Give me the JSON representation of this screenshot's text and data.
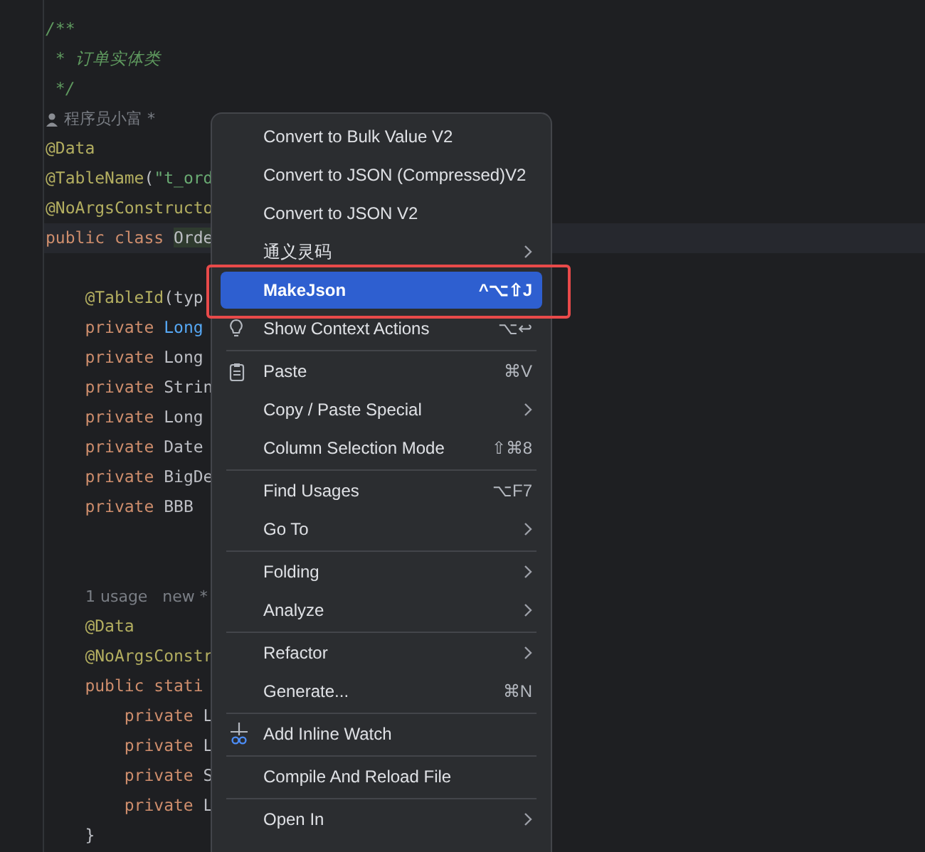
{
  "editor": {
    "lines": [
      {
        "kind": "code",
        "tokens": [
          {
            "kind": "comment",
            "text": "/**"
          }
        ]
      },
      {
        "kind": "code",
        "tokens": [
          {
            "kind": "comment",
            "text": " * 订单实体类"
          }
        ]
      },
      {
        "kind": "code",
        "tokens": [
          {
            "kind": "comment",
            "text": " */"
          }
        ]
      },
      {
        "kind": "author",
        "text": "程序员小富 *"
      },
      {
        "kind": "code",
        "tokens": [
          {
            "kind": "annotation",
            "text": "@Data"
          }
        ]
      },
      {
        "kind": "code",
        "tokens": [
          {
            "kind": "annotation",
            "text": "@TableName"
          },
          {
            "kind": "plain",
            "text": "("
          },
          {
            "kind": "string",
            "text": "\"t_ord"
          }
        ]
      },
      {
        "kind": "code",
        "tokens": [
          {
            "kind": "annotation",
            "text": "@NoArgsConstructo"
          }
        ]
      },
      {
        "kind": "code",
        "current": true,
        "tokens": [
          {
            "kind": "keyword",
            "text": "public class "
          },
          {
            "kind": "match",
            "text": "Orde"
          }
        ]
      },
      {
        "kind": "blank"
      },
      {
        "kind": "code",
        "tokens": [
          {
            "kind": "annotation",
            "text": "    @TableId"
          },
          {
            "kind": "plain",
            "text": "(typ"
          }
        ]
      },
      {
        "kind": "code",
        "tokens": [
          {
            "kind": "keyword",
            "text": "    private "
          },
          {
            "kind": "type",
            "text": "Long"
          }
        ]
      },
      {
        "kind": "code",
        "tokens": [
          {
            "kind": "keyword",
            "text": "    private "
          },
          {
            "kind": "plain",
            "text": "Long"
          }
        ]
      },
      {
        "kind": "code",
        "tokens": [
          {
            "kind": "keyword",
            "text": "    private "
          },
          {
            "kind": "plain",
            "text": "Strin"
          }
        ]
      },
      {
        "kind": "code",
        "tokens": [
          {
            "kind": "keyword",
            "text": "    private "
          },
          {
            "kind": "plain",
            "text": "Long"
          }
        ]
      },
      {
        "kind": "code",
        "tokens": [
          {
            "kind": "keyword",
            "text": "    private "
          },
          {
            "kind": "plain",
            "text": "Date"
          }
        ]
      },
      {
        "kind": "code",
        "tokens": [
          {
            "kind": "keyword",
            "text": "    private "
          },
          {
            "kind": "plain",
            "text": "BigDe"
          }
        ]
      },
      {
        "kind": "code",
        "tokens": [
          {
            "kind": "keyword",
            "text": "    private "
          },
          {
            "kind": "plain",
            "text": "BBB"
          }
        ]
      },
      {
        "kind": "blank"
      },
      {
        "kind": "blank"
      },
      {
        "kind": "hint",
        "text": "1 usage   new *"
      },
      {
        "kind": "code",
        "tokens": [
          {
            "kind": "annotation",
            "text": "    @Data"
          }
        ]
      },
      {
        "kind": "code",
        "tokens": [
          {
            "kind": "annotation",
            "text": "    @NoArgsConstr"
          }
        ]
      },
      {
        "kind": "code",
        "tokens": [
          {
            "kind": "keyword",
            "text": "    public stati"
          }
        ]
      },
      {
        "kind": "code",
        "tokens": [
          {
            "kind": "keyword",
            "text": "        private "
          },
          {
            "kind": "plain",
            "text": "L"
          }
        ]
      },
      {
        "kind": "code",
        "tokens": [
          {
            "kind": "keyword",
            "text": "        private "
          },
          {
            "kind": "plain",
            "text": "L"
          }
        ]
      },
      {
        "kind": "code",
        "tokens": [
          {
            "kind": "keyword",
            "text": "        private "
          },
          {
            "kind": "plain",
            "text": "S"
          }
        ]
      },
      {
        "kind": "code",
        "tokens": [
          {
            "kind": "keyword",
            "text": "        private "
          },
          {
            "kind": "plain",
            "text": "L"
          }
        ]
      },
      {
        "kind": "code",
        "tokens": [
          {
            "kind": "plain",
            "text": "    }"
          }
        ]
      }
    ]
  },
  "context_menu": {
    "items": [
      {
        "kind": "item",
        "label": "Convert to Bulk Value V2",
        "selected": false
      },
      {
        "kind": "item",
        "label": "Convert to JSON (Compressed)V2",
        "selected": false
      },
      {
        "kind": "item",
        "label": "Convert to JSON V2",
        "selected": false
      },
      {
        "kind": "item",
        "label": "通义灵码",
        "submenu": true,
        "selected": false
      },
      {
        "kind": "item",
        "label": "MakeJson",
        "shortcut": "^⌥⇧J",
        "selected": true,
        "annotated": true
      },
      {
        "kind": "item",
        "label": "Show Context Actions",
        "shortcut": "⌥↩",
        "selected": false
      },
      {
        "kind": "separator"
      },
      {
        "kind": "item",
        "label": "Paste",
        "shortcut": "⌘V",
        "selected": false
      },
      {
        "kind": "item",
        "label": "Copy / Paste Special",
        "submenu": true,
        "selected": false
      },
      {
        "kind": "item",
        "label": "Column Selection Mode",
        "shortcut": "⇧⌘8",
        "selected": false
      },
      {
        "kind": "separator"
      },
      {
        "kind": "item",
        "label": "Find Usages",
        "shortcut": "⌥F7",
        "selected": false
      },
      {
        "kind": "item",
        "label": "Go To",
        "submenu": true,
        "selected": false
      },
      {
        "kind": "separator"
      },
      {
        "kind": "item",
        "label": "Folding",
        "submenu": true,
        "selected": false
      },
      {
        "kind": "item",
        "label": "Analyze",
        "submenu": true,
        "selected": false
      },
      {
        "kind": "separator"
      },
      {
        "kind": "item",
        "label": "Refactor",
        "submenu": true,
        "selected": false
      },
      {
        "kind": "item",
        "label": "Generate...",
        "shortcut": "⌘N",
        "selected": false
      },
      {
        "kind": "separator"
      },
      {
        "kind": "item",
        "label": "Add Inline Watch",
        "selected": false
      },
      {
        "kind": "separator"
      },
      {
        "kind": "item",
        "label": "Compile And Reload File",
        "selected": false
      },
      {
        "kind": "separator"
      },
      {
        "kind": "item",
        "label": "Open In",
        "submenu": true,
        "selected": false
      }
    ]
  }
}
